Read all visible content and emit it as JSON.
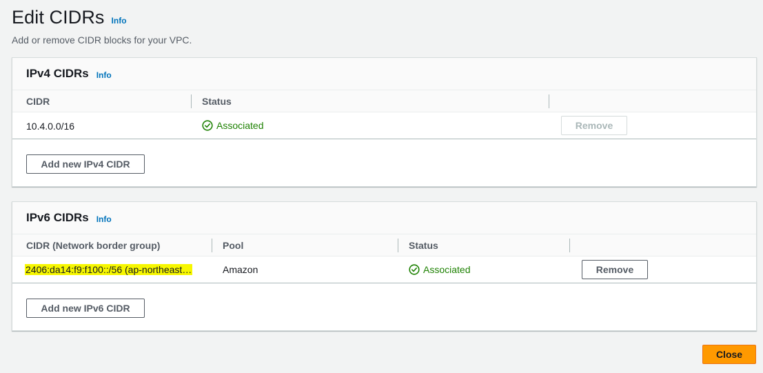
{
  "header": {
    "title": "Edit CIDRs",
    "info_label": "Info",
    "description": "Add or remove CIDR blocks for your VPC."
  },
  "ipv4": {
    "title": "IPv4 CIDRs",
    "info_label": "Info",
    "columns": [
      "CIDR",
      "Status"
    ],
    "rows": [
      {
        "cidr": "10.4.0.0/16",
        "status": "Associated",
        "remove_label": "Remove"
      }
    ],
    "add_label": "Add new IPv4 CIDR"
  },
  "ipv6": {
    "title": "IPv6 CIDRs",
    "info_label": "Info",
    "columns": [
      "CIDR (Network border group)",
      "Pool",
      "Status"
    ],
    "rows": [
      {
        "cidr": "2406:da14:f9:f100::/56 (ap-northeast…",
        "pool": "Amazon",
        "status": "Associated",
        "remove_label": "Remove"
      }
    ],
    "add_label": "Add new IPv6 CIDR"
  },
  "footer": {
    "close_label": "Close"
  },
  "colors": {
    "accent": "#ff9900",
    "link": "#0073bb",
    "success": "#1d8102",
    "highlight": "#f7f700"
  },
  "icons": {
    "status": "check-circle-icon"
  }
}
